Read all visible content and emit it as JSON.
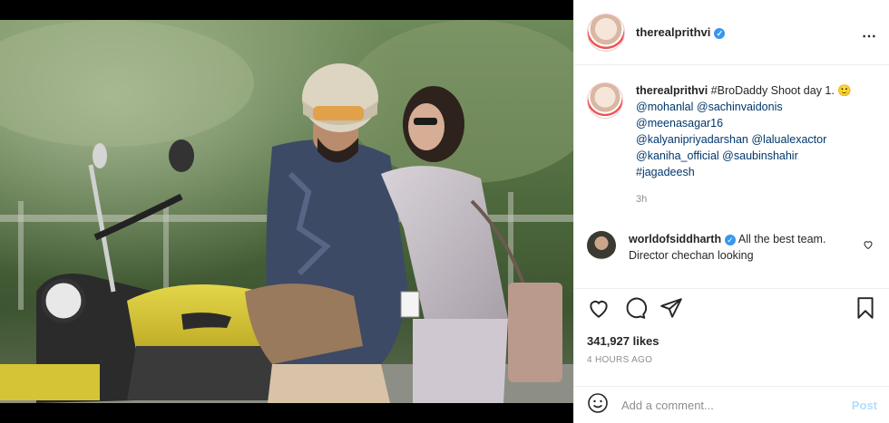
{
  "post": {
    "author": {
      "username": "therealprithvi",
      "verified_mark": "✓"
    },
    "more_icon": "⋯",
    "caption": {
      "username": "therealprithvi",
      "text_1": " #BroDaddy Shoot day 1. ",
      "emoji": "🙂",
      "tags": [
        "@mohanlal",
        "@sachinvaidonis",
        "@meenasagar16",
        "@kalyanipriyadarshan",
        "@lalualexactor",
        "@kaniha_official",
        "@saubinshahir",
        "#jagadeesh"
      ],
      "time": "3h"
    },
    "reply": {
      "username": "worldofsiddharth",
      "text": " All the best team. Director chechan looking"
    },
    "likes": "341,927 likes",
    "date": "4 HOURS AGO",
    "comment_box": {
      "placeholder": "Add a comment...",
      "post_label": "Post"
    },
    "colors": {
      "verified": "#3897f0",
      "link": "#00376b",
      "post_button": "#b2dffc"
    },
    "icons": [
      "heart-icon",
      "comment-icon",
      "share-icon",
      "bookmark-icon",
      "emoji-icon",
      "more-icon"
    ]
  }
}
